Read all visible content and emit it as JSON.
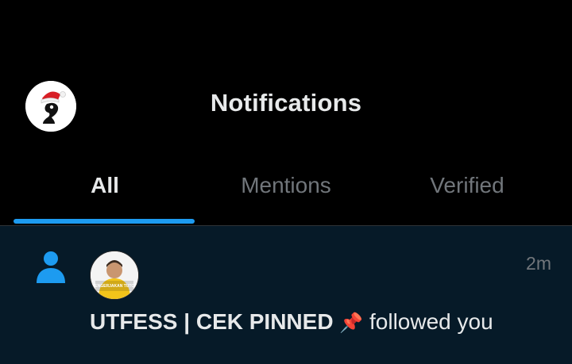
{
  "header": {
    "title": "Notifications",
    "profile_icon": "santa-hat-logo-icon"
  },
  "tabs": [
    {
      "label": "All",
      "active": true
    },
    {
      "label": "Mentions",
      "active": false
    },
    {
      "label": "Verified",
      "active": false
    }
  ],
  "colors": {
    "accent": "#1d9bf0",
    "background": "#000000",
    "notification_bg": "#061a28",
    "text_primary": "#e7e9ea",
    "text_secondary": "#71767b"
  },
  "notifications": [
    {
      "type_icon": "person-icon",
      "avatar_caption": "MENGERJAKAN TUTOR",
      "time": "2m",
      "user_name": "UTFESS | CEK PINNED",
      "emoji": "📌",
      "action": "followed you"
    }
  ]
}
